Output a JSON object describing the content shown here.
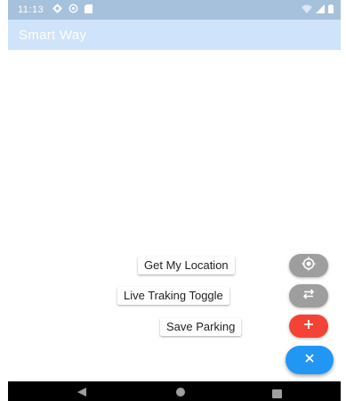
{
  "status_bar": {
    "time": "11:13",
    "left_icons": [
      "gear-icon",
      "at-sign-icon",
      "sd-card-icon"
    ],
    "right_icons": [
      "wifi-icon",
      "signal-icon",
      "battery-icon"
    ]
  },
  "app_bar": {
    "title": "Smart Way",
    "color": "#cfe3fa"
  },
  "fab_menu": {
    "items": [
      {
        "label": "Get My Location",
        "icon": "location-target-icon",
        "color": "#9e9e9e"
      },
      {
        "label": "Live Traking Toggle",
        "icon": "swap-arrows-icon",
        "color": "#9e9e9e"
      },
      {
        "label": "Save Parking",
        "icon": "plus-icon",
        "color": "#f44336"
      }
    ],
    "main_button": {
      "icon": "close-icon",
      "color": "#2196f3"
    }
  },
  "nav_bar": {
    "icons": [
      "back-icon",
      "home-icon",
      "recents-icon"
    ]
  }
}
